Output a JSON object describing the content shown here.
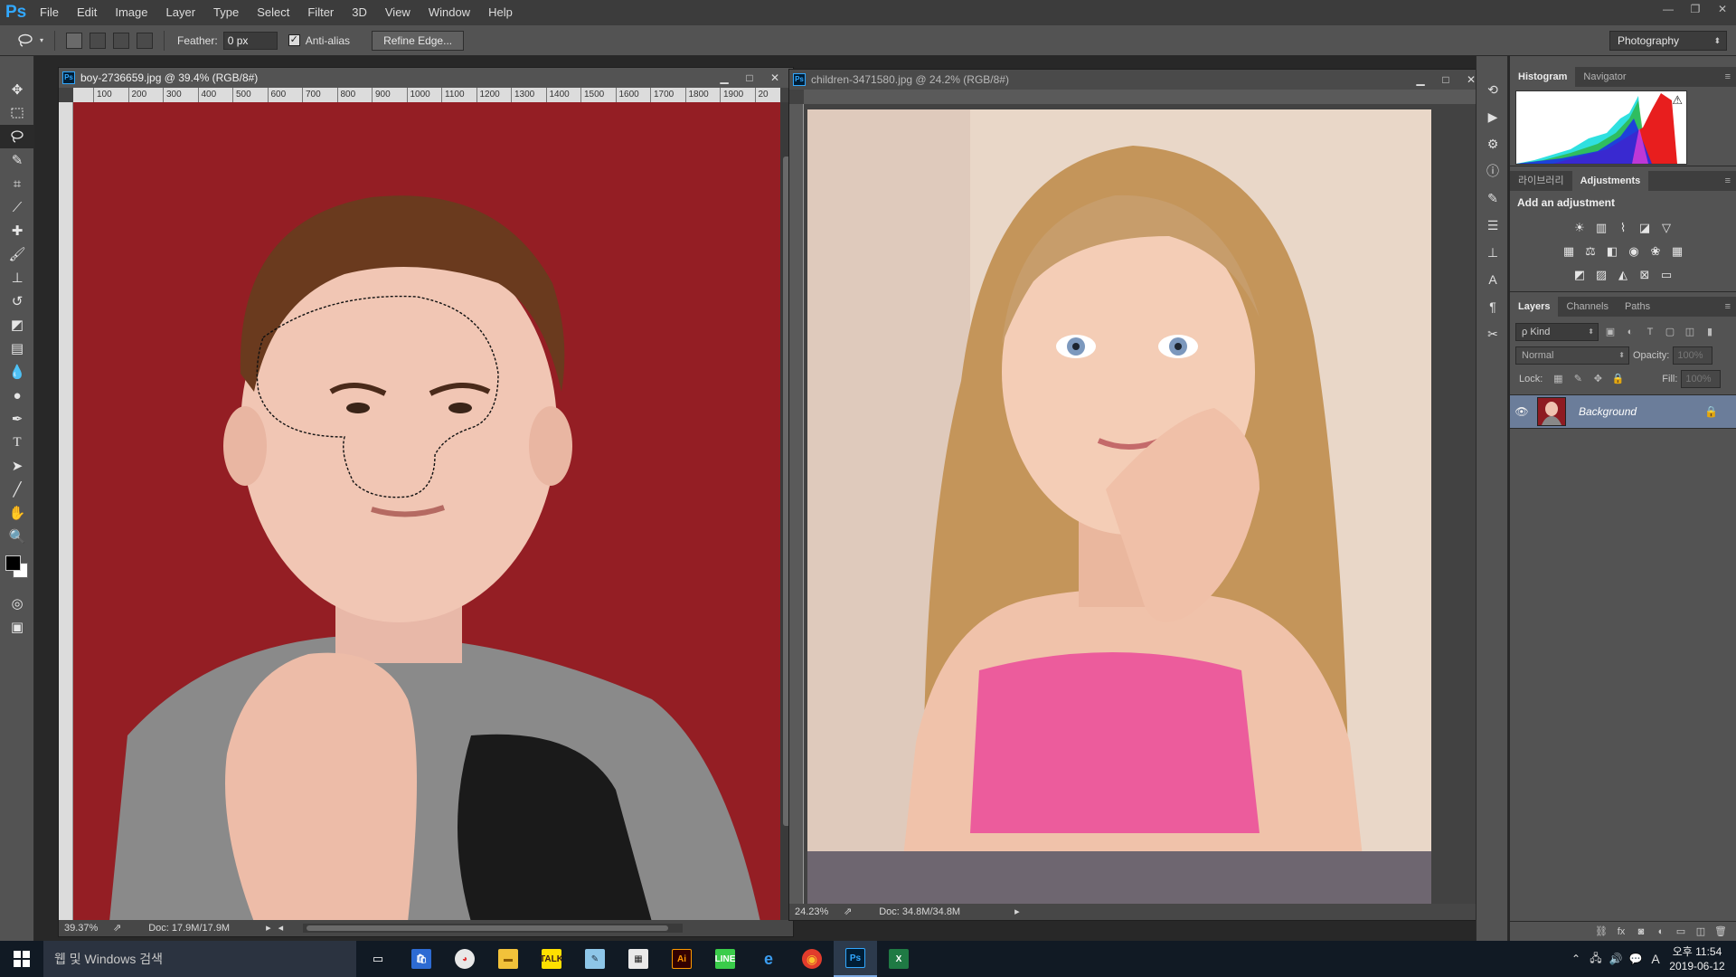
{
  "app": {
    "logo": "Ps",
    "accent": "#31a8ff"
  },
  "menu": [
    "File",
    "Edit",
    "Image",
    "Layer",
    "Type",
    "Select",
    "Filter",
    "3D",
    "View",
    "Window",
    "Help"
  ],
  "window_controls": {
    "minimize": "—",
    "restore": "❐",
    "close": "✕"
  },
  "options": {
    "tool_icon": "lasso-icon",
    "feather_label": "Feather:",
    "feather_value": "0 px",
    "antialias_checked": true,
    "antialias_check": "✓",
    "antialias_label": "Anti-alias",
    "refine_label": "Refine Edge...",
    "workspace": "Photography"
  },
  "tools": [
    "move",
    "marquee",
    "lasso",
    "quick-select",
    "crop",
    "eyedropper",
    "healing",
    "brush",
    "stamp",
    "history-brush",
    "eraser",
    "gradient",
    "blur",
    "dodge",
    "pen",
    "type",
    "path-select",
    "line",
    "hand",
    "zoom"
  ],
  "documents": [
    {
      "title": "boy-2736659.jpg @ 39.4% (RGB/8#)",
      "ruler": [
        "100",
        "200",
        "300",
        "400",
        "500",
        "600",
        "700",
        "800",
        "900",
        "1000",
        "1100",
        "1200",
        "1300",
        "1400",
        "1500",
        "1600",
        "1700",
        "1800",
        "1900",
        "20"
      ],
      "zoom": "39.37%",
      "doc_info": "Doc: 17.9M/17.9M",
      "background_color": "#8e1b22",
      "active": true
    },
    {
      "title": "children-3471580.jpg @ 24.2% (RGB/8#)",
      "zoom": "24.23%",
      "doc_info": "Doc: 34.8M/34.8M",
      "background_color": "#e9d7c8",
      "active": false
    }
  ],
  "doc_controls": {
    "minimize": "▁",
    "maximize": "□",
    "close": "✕"
  },
  "panels": {
    "histogram_tabs": [
      "Histogram",
      "Navigator"
    ],
    "histogram_warning": "⚠",
    "adjust_tabs": [
      "라이브러리",
      "Adjustments"
    ],
    "adjust_title": "Add an adjustment",
    "layers_tabs": [
      "Layers",
      "Channels",
      "Paths"
    ],
    "filter_kind": "ρ Kind",
    "blend_mode": "Normal",
    "opacity_label": "Opacity:",
    "opacity_value": "100%",
    "lock_label": "Lock:",
    "fill_label": "Fill:",
    "fill_value": "100%",
    "layer_name": "Background"
  },
  "taskbar": {
    "search_placeholder": "웹 및 Windows 검색",
    "apps": [
      "task-view",
      "store",
      "paint",
      "explorer",
      "kakaotalk",
      "notepad",
      "calculator",
      "illustrator",
      "line",
      "edge",
      "chrome",
      "photoshop",
      "excel"
    ],
    "ime": "A",
    "time": "오후 11:54",
    "date": "2019-06-12"
  }
}
